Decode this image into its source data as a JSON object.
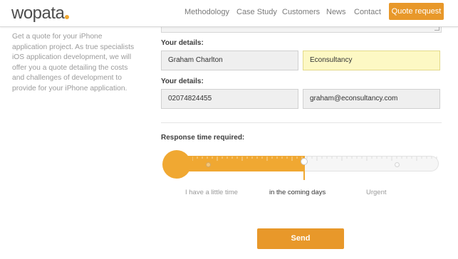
{
  "brand": {
    "name": "wopata",
    "accent": "#f0a832",
    "accent_dark": "#e8982a"
  },
  "nav": {
    "items": [
      {
        "label": "Methodology"
      },
      {
        "label": "Case Study"
      },
      {
        "label": "Customers"
      },
      {
        "label": "News"
      },
      {
        "label": "Contact"
      }
    ],
    "quote_label": "Quote request"
  },
  "intro": {
    "text": "Get a quote for your iPhone application project. As true specialists iOS application development, we will offer you a quote detailing the costs and challenges of development to provide for your iPhone application."
  },
  "form": {
    "details_label_1": "Your details:",
    "name_value": "Graham Charlton",
    "company_value": "Econsultancy",
    "details_label_2": "Your details:",
    "phone_value": "02074824455",
    "email_value": "graham@econsultancy.com",
    "response_label": "Response time required:",
    "response_options": [
      {
        "label": "I have a little time"
      },
      {
        "label": "in the coming days"
      },
      {
        "label": "Urgent"
      }
    ],
    "response_selected": "in the coming days",
    "response_level": 0.5,
    "send_label": "Send"
  }
}
